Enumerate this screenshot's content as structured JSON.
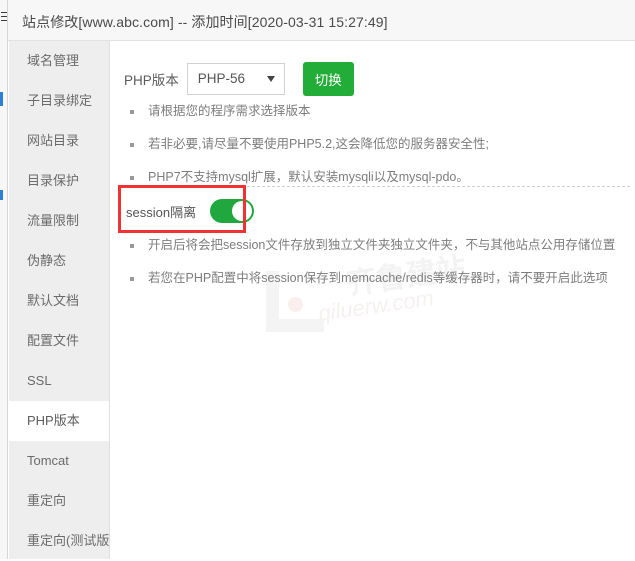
{
  "header": {
    "title": "站点修改[www.abc.com] -- 添加时间[2020-03-31 15:27:49]"
  },
  "sidebar": {
    "items": [
      {
        "label": "域名管理",
        "active": false
      },
      {
        "label": "子目录绑定",
        "active": false
      },
      {
        "label": "网站目录",
        "active": false
      },
      {
        "label": "目录保护",
        "active": false
      },
      {
        "label": "流量限制",
        "active": false
      },
      {
        "label": "伪静态",
        "active": false
      },
      {
        "label": "默认文档",
        "active": false
      },
      {
        "label": "配置文件",
        "active": false
      },
      {
        "label": "SSL",
        "active": false
      },
      {
        "label": "PHP版本",
        "active": true
      },
      {
        "label": "Tomcat",
        "active": false
      },
      {
        "label": "重定向",
        "active": false
      },
      {
        "label": "重定向(测试版)",
        "active": false
      }
    ]
  },
  "main": {
    "php_version": {
      "label": "PHP版本",
      "selected": "PHP-56",
      "options": [
        "PHP-56"
      ],
      "switch_button": "切换"
    },
    "version_notes": [
      "请根据您的程序需求选择版本",
      "若非必要,请尽量不要使用PHP5.2,这会降低您的服务器安全性;",
      "PHP7不支持mysql扩展，默认安装mysqli以及mysql-pdo。"
    ],
    "session": {
      "label": "session隔离",
      "enabled": true,
      "toggle_state": "on"
    },
    "session_notes": [
      "开启后将会把session文件存放到独立文件夹独立文件夹，不与其他站点公用存储位置",
      "若您在PHP配置中将session保存到memcache/redis等缓存器时，请不要开启此选项"
    ]
  },
  "watermark": {
    "text_cn": "齐鲁建站",
    "text_url": "qiluerw.com"
  },
  "colors": {
    "accent_green": "#22ac38",
    "toggle_green": "#20a83e",
    "annotation_red": "#f03232",
    "sidebar_bg": "#eeeeee",
    "header_bg": "#f7f7f7"
  }
}
